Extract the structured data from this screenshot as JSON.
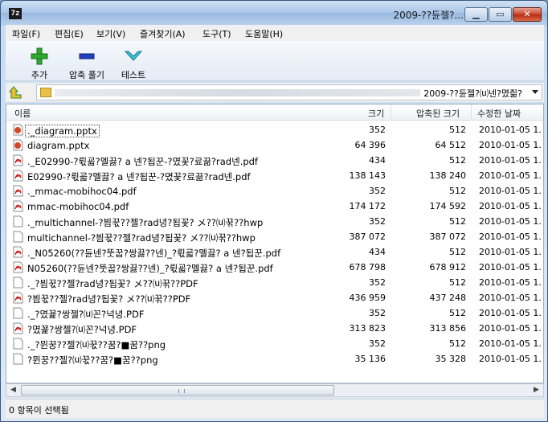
{
  "window": {
    "title": "2009-??듄젤?...",
    "app_icon": "7z"
  },
  "window_controls": {
    "minimize": "▁",
    "maximize": "▭",
    "close": "✕"
  },
  "menu": [
    "파일(F)",
    "편집(E)",
    "보기(V)",
    "즐겨찾기(A)",
    "도구(T)",
    "도움말(H)"
  ],
  "toolbar": {
    "add_label": "추가",
    "extract_label": "압축 풀기",
    "test_label": "테스트"
  },
  "toolbar_icons": {
    "add": "plus-icon",
    "extract": "minus-icon",
    "test": "checkmark-icon"
  },
  "address": {
    "path": "2009-??듄젤?⒰넨?몄즮?"
  },
  "columns": {
    "name": "이름",
    "size": "크기",
    "packed": "압축된 크기",
    "modified": "수정한 날짜"
  },
  "files": [
    {
      "name": "._diagram.pptx",
      "type": "pptx",
      "size": "352",
      "packed": "512",
      "modified": "2010-01-05 1."
    },
    {
      "name": "diagram.pptx",
      "type": "pptx",
      "size": "64 396",
      "packed": "64 512",
      "modified": "2010-01-05 1."
    },
    {
      "name": "._E02990-?뤿굛?멜끓? a 넨?됩꾼-?몄꽃?료끎?rad넨.pdf",
      "type": "pdf",
      "size": "434",
      "packed": "512",
      "modified": "2010-01-05 1."
    },
    {
      "name": "E02990-?뤿굛?멜끓? a 넨?됩꾼-?몄꽃?료끎?rad넨.pdf",
      "type": "pdf",
      "size": "138 143",
      "packed": "138 240",
      "modified": "2010-01-05 1."
    },
    {
      "name": "._mmac-mobihoc04.pdf",
      "type": "pdf",
      "size": "352",
      "packed": "512",
      "modified": "2010-01-05 1."
    },
    {
      "name": "mmac-mobihoc04.pdf",
      "type": "pdf",
      "size": "174 172",
      "packed": "174 592",
      "modified": "2010-01-05 1."
    },
    {
      "name": "._multichannel-?븸꾻??젤?rad녕?됩꽃? メ??⒰꾺??hwp",
      "type": "generic",
      "size": "352",
      "packed": "512",
      "modified": "2010-01-05 1."
    },
    {
      "name": "multichannel-?븸꾻??젤?rad녕?됩꽃? メ??⒰꾺??hwp",
      "type": "generic",
      "size": "387 072",
      "packed": "387 072",
      "modified": "2010-01-05 1."
    },
    {
      "name": "._N05260(??듄넨?뚯꿉?쌍끓??넨)_?뤿굛?멜끓? a 넨?됩꾼.pdf",
      "type": "pdf",
      "size": "434",
      "packed": "512",
      "modified": "2010-01-05 1."
    },
    {
      "name": "N05260(??듄넨?뚯꿉?쌍끓??넨)_?뤿굛?멜끓? a 넨?됩꾼.pdf",
      "type": "pdf",
      "size": "678 798",
      "packed": "678 912",
      "modified": "2010-01-05 1."
    },
    {
      "name": "._?븸꾻??젤?rad녕?됩꽃? メ??⒰꾺??PDF",
      "type": "generic",
      "size": "352",
      "packed": "512",
      "modified": "2010-01-05 1."
    },
    {
      "name": "?븸꾻??젤?rad녕?됩꽃? メ??⒰꾺??PDF",
      "type": "pdf",
      "size": "436 959",
      "packed": "437 248",
      "modified": "2010-01-05 1."
    },
    {
      "name": "._?몄꾩?쌍젤?⒰꼰?넉녕.PDF",
      "type": "generic",
      "size": "352",
      "packed": "512",
      "modified": "2010-01-05 1."
    },
    {
      "name": "?몄꾩?쌍젤?⒰꼰?넉녕.PDF",
      "type": "pdf",
      "size": "313 823",
      "packed": "313 856",
      "modified": "2010-01-05 1."
    },
    {
      "name": "._?뮌꿍??젤?⒰꾻??꿈?■꿈??png",
      "type": "generic",
      "size": "352",
      "packed": "512",
      "modified": "2010-01-05 1."
    },
    {
      "name": "?뮌꿍??젤?⒰꾻??꿈?■꿈??png",
      "type": "generic",
      "size": "35 136",
      "packed": "35 328",
      "modified": "2010-01-05 1."
    }
  ],
  "scrollbar": {
    "left_arrow": "◀",
    "right_arrow": "▶"
  },
  "status": {
    "text": "0 항목이 선택됨"
  }
}
